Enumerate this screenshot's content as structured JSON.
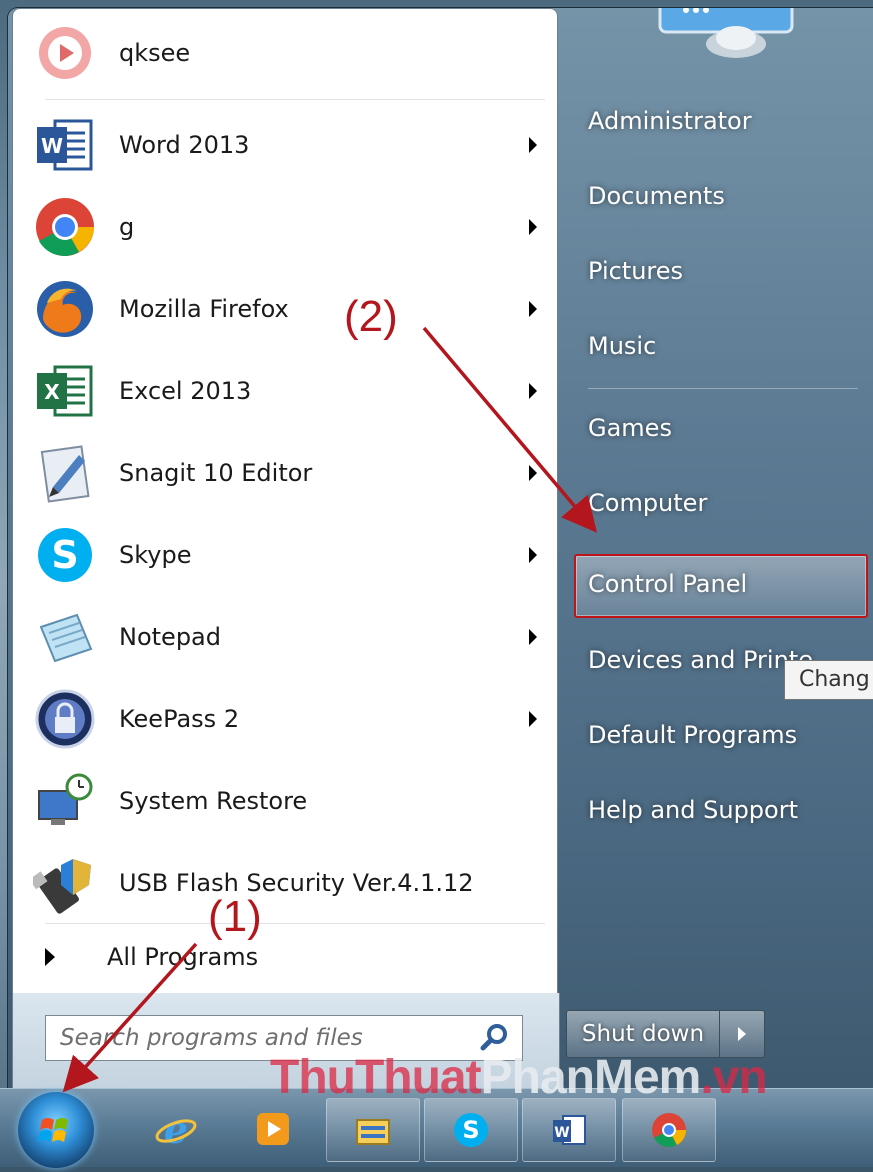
{
  "programs": [
    {
      "label": "qksee",
      "icon": "qksee-icon",
      "has_submenu": false
    },
    {
      "label": "Word 2013",
      "icon": "word-icon",
      "has_submenu": true
    },
    {
      "label": "g",
      "icon": "chrome-icon",
      "has_submenu": true
    },
    {
      "label": "Mozilla Firefox",
      "icon": "firefox-icon",
      "has_submenu": true
    },
    {
      "label": "Excel 2013",
      "icon": "excel-icon",
      "has_submenu": true
    },
    {
      "label": "Snagit 10 Editor",
      "icon": "snagit-icon",
      "has_submenu": true
    },
    {
      "label": "Skype",
      "icon": "skype-icon",
      "has_submenu": true
    },
    {
      "label": "Notepad",
      "icon": "notepad-icon",
      "has_submenu": true
    },
    {
      "label": "KeePass 2",
      "icon": "keepass-icon",
      "has_submenu": true
    },
    {
      "label": "System Restore",
      "icon": "system-restore-icon",
      "has_submenu": false
    },
    {
      "label": "USB Flash Security Ver.4.1.12",
      "icon": "usb-flash-icon",
      "has_submenu": false
    }
  ],
  "all_programs_label": "All Programs",
  "search": {
    "placeholder": "Search programs and files"
  },
  "places": [
    {
      "label": "Administrator"
    },
    {
      "label": "Documents"
    },
    {
      "label": "Pictures"
    },
    {
      "label": "Music"
    },
    {
      "label": "Games"
    },
    {
      "label": "Computer"
    },
    {
      "label": "Control Panel",
      "highlighted": true
    },
    {
      "label": "Devices and Printe"
    },
    {
      "label": "Default Programs"
    },
    {
      "label": "Help and Support"
    }
  ],
  "tooltip": "Chang",
  "shutdown_label": "Shut down",
  "taskbar": [
    "start-orb",
    "internet-explorer-icon",
    "media-player-icon",
    "file-explorer-icon",
    "skype-icon",
    "word-icon",
    "chrome-icon"
  ],
  "annotations": {
    "step1": "(1)",
    "step2": "(2)"
  },
  "watermark": {
    "part1": "ThuThuat",
    "part2": "PhanMem",
    "part3": ".vn"
  },
  "colors": {
    "annotation": "#b3161c",
    "highlight_border": "#c0141b"
  }
}
